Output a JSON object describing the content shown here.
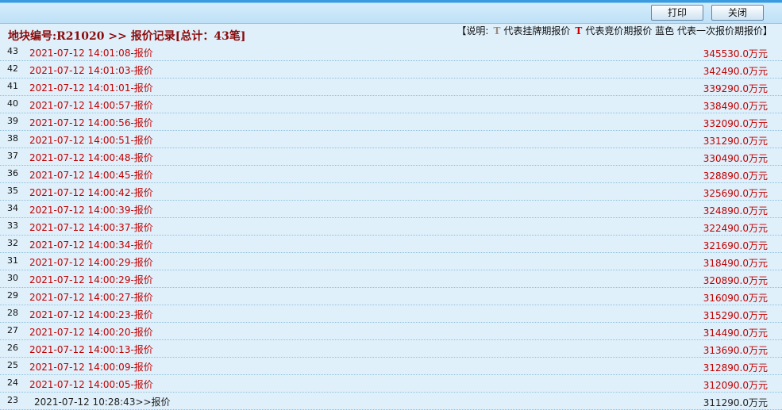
{
  "toolbar": {
    "print_label": "打印",
    "close_label": "关闭"
  },
  "header": {
    "title": "地块编号:R21020 >> 报价记录[总计：43笔]",
    "legend": {
      "open": "【说明:",
      "t_list_glyph": "T",
      "t_list_text": "代表挂牌期报价",
      "t_bid_glyph": "T",
      "t_bid_text": "代表竞价期报价",
      "blue_text": "蓝色 代表一次报价期报价】"
    }
  },
  "bids": [
    {
      "no": "43",
      "time": "2021-07-12 14:01:08-报价",
      "amount": "345530.0万元"
    },
    {
      "no": "42",
      "time": "2021-07-12 14:01:03-报价",
      "amount": "342490.0万元"
    },
    {
      "no": "41",
      "time": "2021-07-12 14:01:01-报价",
      "amount": "339290.0万元"
    },
    {
      "no": "40",
      "time": "2021-07-12 14:00:57-报价",
      "amount": "338490.0万元"
    },
    {
      "no": "39",
      "time": "2021-07-12 14:00:56-报价",
      "amount": "332090.0万元"
    },
    {
      "no": "38",
      "time": "2021-07-12 14:00:51-报价",
      "amount": "331290.0万元"
    },
    {
      "no": "37",
      "time": "2021-07-12 14:00:48-报价",
      "amount": "330490.0万元"
    },
    {
      "no": "36",
      "time": "2021-07-12 14:00:45-报价",
      "amount": "328890.0万元"
    },
    {
      "no": "35",
      "time": "2021-07-12 14:00:42-报价",
      "amount": "325690.0万元"
    },
    {
      "no": "34",
      "time": "2021-07-12 14:00:39-报价",
      "amount": "324890.0万元"
    },
    {
      "no": "33",
      "time": "2021-07-12 14:00:37-报价",
      "amount": "322490.0万元"
    },
    {
      "no": "32",
      "time": "2021-07-12 14:00:34-报价",
      "amount": "321690.0万元"
    },
    {
      "no": "31",
      "time": "2021-07-12 14:00:29-报价",
      "amount": "318490.0万元"
    },
    {
      "no": "30",
      "time": "2021-07-12 14:00:29-报价",
      "amount": "320890.0万元"
    },
    {
      "no": "29",
      "time": "2021-07-12 14:00:27-报价",
      "amount": "316090.0万元"
    },
    {
      "no": "28",
      "time": "2021-07-12 14:00:23-报价",
      "amount": "315290.0万元"
    },
    {
      "no": "27",
      "time": "2021-07-12 14:00:20-报价",
      "amount": "314490.0万元"
    },
    {
      "no": "26",
      "time": "2021-07-12 14:00:13-报价",
      "amount": "313690.0万元"
    },
    {
      "no": "25",
      "time": "2021-07-12 14:00:09-报价",
      "amount": "312890.0万元"
    },
    {
      "no": "24",
      "time": "2021-07-12 14:00:05-报价",
      "amount": "312090.0万元"
    },
    {
      "no": "23",
      "time": "2021-07-12 10:28:43>>报价",
      "amount": "311290.0万元"
    }
  ]
}
